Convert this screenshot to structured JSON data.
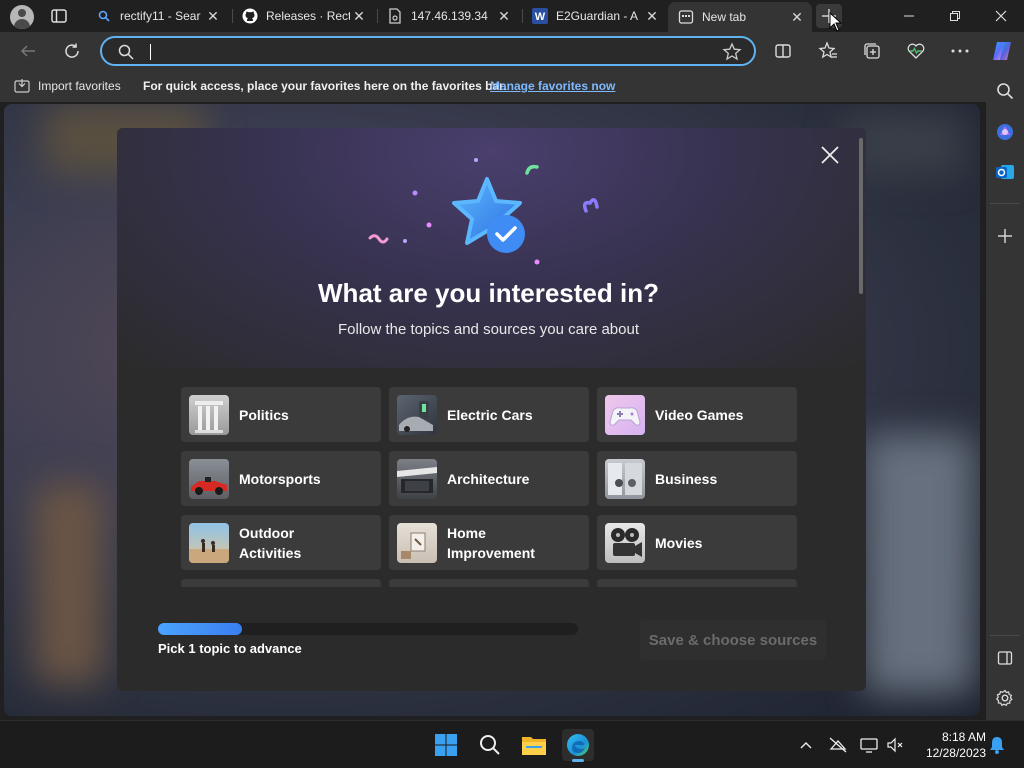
{
  "tabs": [
    {
      "title": "rectify11 - Sear",
      "icon": "search-icon",
      "active": false
    },
    {
      "title": "Releases · Recti",
      "icon": "github-icon",
      "active": false
    },
    {
      "title": "147.46.139.34",
      "icon": "page-lock-icon",
      "active": false
    },
    {
      "title": "E2Guardian - A",
      "icon": "wordpress-icon",
      "active": false
    },
    {
      "title": "New tab",
      "icon": "newtab-icon",
      "active": true
    }
  ],
  "address": {
    "value": "",
    "placeholder": ""
  },
  "favorites_bar": {
    "import_label": "Import favorites",
    "message": "For quick access, place your favorites here on the favorites bar.",
    "manage_link": "Manage favorites now"
  },
  "dialog": {
    "title": "What are you interested in?",
    "subtitle": "Follow the topics and sources you care about",
    "topics": [
      {
        "label": "Politics",
        "thumb": "politics"
      },
      {
        "label": "Electric Cars",
        "thumb": "electric-cars"
      },
      {
        "label": "Video Games",
        "thumb": "video-games"
      },
      {
        "label": "Motorsports",
        "thumb": "motorsports"
      },
      {
        "label": "Architecture",
        "thumb": "architecture"
      },
      {
        "label": "Business",
        "thumb": "business"
      },
      {
        "label": "Outdoor\nActivities",
        "thumb": "outdoor"
      },
      {
        "label": "Home\nImprovement",
        "thumb": "home"
      },
      {
        "label": "Movies",
        "thumb": "movies"
      }
    ],
    "progress": {
      "fraction": 0.2,
      "label": "Pick 1 topic to advance"
    },
    "save_button": "Save & choose sources"
  },
  "clock": {
    "time": "8:18 AM",
    "date": "12/28/2023"
  },
  "colors": {
    "accent": "#5fb3f0",
    "link": "#7fb9ff",
    "progress": "#4aa3ff"
  }
}
